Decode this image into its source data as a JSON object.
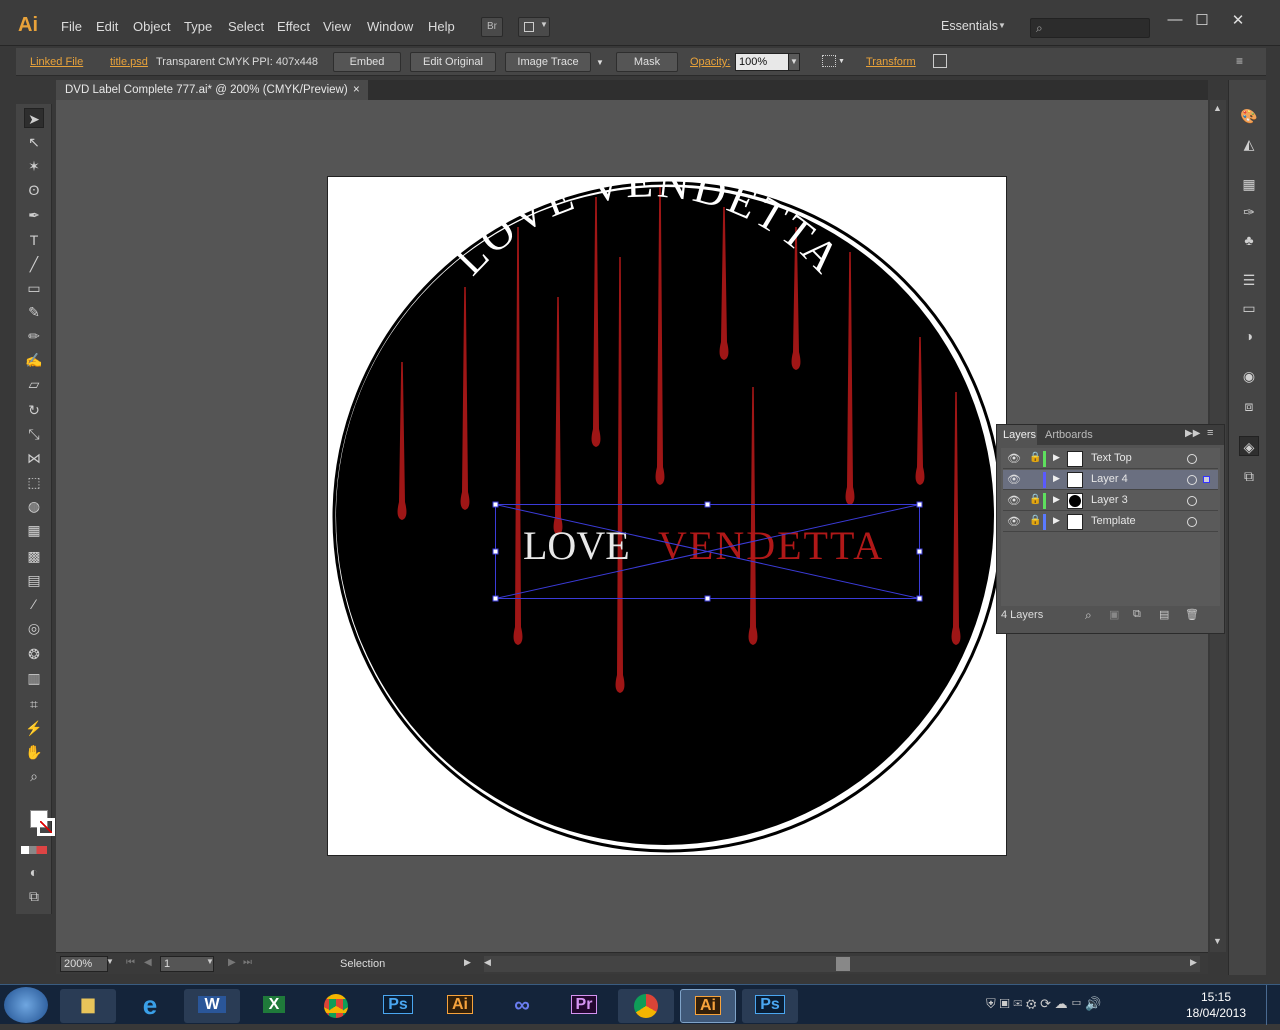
{
  "app": {
    "logo": "Ai"
  },
  "menu": {
    "items": [
      "File",
      "Edit",
      "Object",
      "Type",
      "Select",
      "Effect",
      "View",
      "Window",
      "Help"
    ],
    "bridge_label": "Br",
    "workspace": "Essentials",
    "search_placeholder": ""
  },
  "window_controls": {
    "minimize": "—",
    "maximize": "☐",
    "close": "✕"
  },
  "control_bar": {
    "linked_file": "Linked File",
    "file_name": "title.psd",
    "color_mode": "Transparent CMYK",
    "ppi": "PPI: 407x448",
    "embed": "Embed",
    "edit_original": "Edit Original",
    "image_trace": "Image Trace",
    "mask": "Mask",
    "opacity_label": "Opacity:",
    "opacity_value": "100%",
    "transform": "Transform"
  },
  "document": {
    "tab_title": "DVD Label Complete 777.ai* @ 200% (CMYK/Preview)",
    "tab_close": "×"
  },
  "artwork": {
    "arc_title": "LOVE VENDETTA",
    "center_word1": "LOVE",
    "center_word2": "VENDETTA"
  },
  "status": {
    "zoom": "200%",
    "artboard": "1",
    "tool_name": "Selection"
  },
  "layers_panel": {
    "tab_layers": "Layers",
    "tab_artboards": "Artboards",
    "count": "4 Layers",
    "layers": [
      {
        "name": "Text Top",
        "color": "#5ee05e",
        "locked": true,
        "selected": false
      },
      {
        "name": "Layer 4",
        "color": "#5a5aff",
        "locked": false,
        "selected": true
      },
      {
        "name": "Layer 3",
        "color": "#5ee05e",
        "locked": true,
        "selected": false
      },
      {
        "name": "Template",
        "color": "#5a7aff",
        "locked": true,
        "selected": false
      }
    ]
  },
  "taskbar": {
    "apps": [
      "Explorer",
      "Internet Explorer",
      "Word",
      "Excel",
      "Chrome",
      "Photoshop",
      "Illustrator",
      "Infinity",
      "Premiere",
      "Chrome",
      "Illustrator",
      "Photoshop"
    ],
    "labels": {
      "ps": "Ps",
      "ai": "Ai",
      "pr": "Pr",
      "w": "W",
      "x": "X"
    },
    "time": "15:15",
    "date": "18/04/2013"
  },
  "colors": {
    "accent": "#e8a23a",
    "blood": "#b01818",
    "selection": "#3333cc"
  }
}
